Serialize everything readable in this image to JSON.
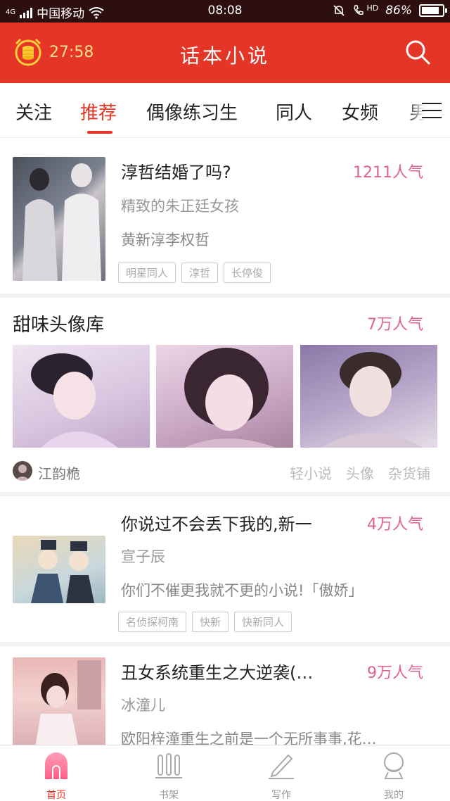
{
  "status_bar": {
    "network": "4G",
    "carrier": "中国移动",
    "time": "08:08",
    "hd": "HD",
    "battery_text": "86%",
    "battery_level": 0.86
  },
  "header": {
    "timer": "27:58",
    "title": "话本小说"
  },
  "tabs": [
    {
      "label": "关注"
    },
    {
      "label": "推荐"
    },
    {
      "label": "偶像练习生"
    },
    {
      "label": "同人"
    },
    {
      "label": "女频"
    },
    {
      "label": "男"
    }
  ],
  "active_tab_index": 1,
  "feed": {
    "book1": {
      "title": "淳哲结婚了吗?",
      "popularity": "1211人气",
      "author": "精致的朱正廷女孩",
      "desc": "黄新淳李权哲",
      "tags": [
        "明星同人",
        "淳哲",
        "长停俊"
      ]
    },
    "gallery": {
      "title": "甜味头像库",
      "popularity": "7万人气",
      "user": "江韵桅",
      "tags": [
        "轻小说",
        "头像",
        "杂货铺"
      ]
    },
    "book2": {
      "title": "你说过不会丢下我的,新一",
      "popularity": "4万人气",
      "author": "宣子辰",
      "desc": "你们不催更我就不更的小说!「傲娇」",
      "tags": [
        "名侦探柯南",
        "快新",
        "快新同人"
      ]
    },
    "book3": {
      "title": "丑女系统重生之大逆袭(…",
      "popularity": "9万人气",
      "author": "冰潼儿",
      "desc": "欧阳梓潼重生之前是一个无所事事,花…"
    }
  },
  "bottom_nav": [
    {
      "label": "首页",
      "icon": "home-icon"
    },
    {
      "label": "书架",
      "icon": "bookshelf-icon"
    },
    {
      "label": "写作",
      "icon": "pencil-icon"
    },
    {
      "label": "我的",
      "icon": "profile-icon"
    }
  ],
  "active_nav_index": 0,
  "colors": {
    "accent": "#e53527",
    "popularity": "#e0648a",
    "status_bar": "#2e0f0f"
  }
}
